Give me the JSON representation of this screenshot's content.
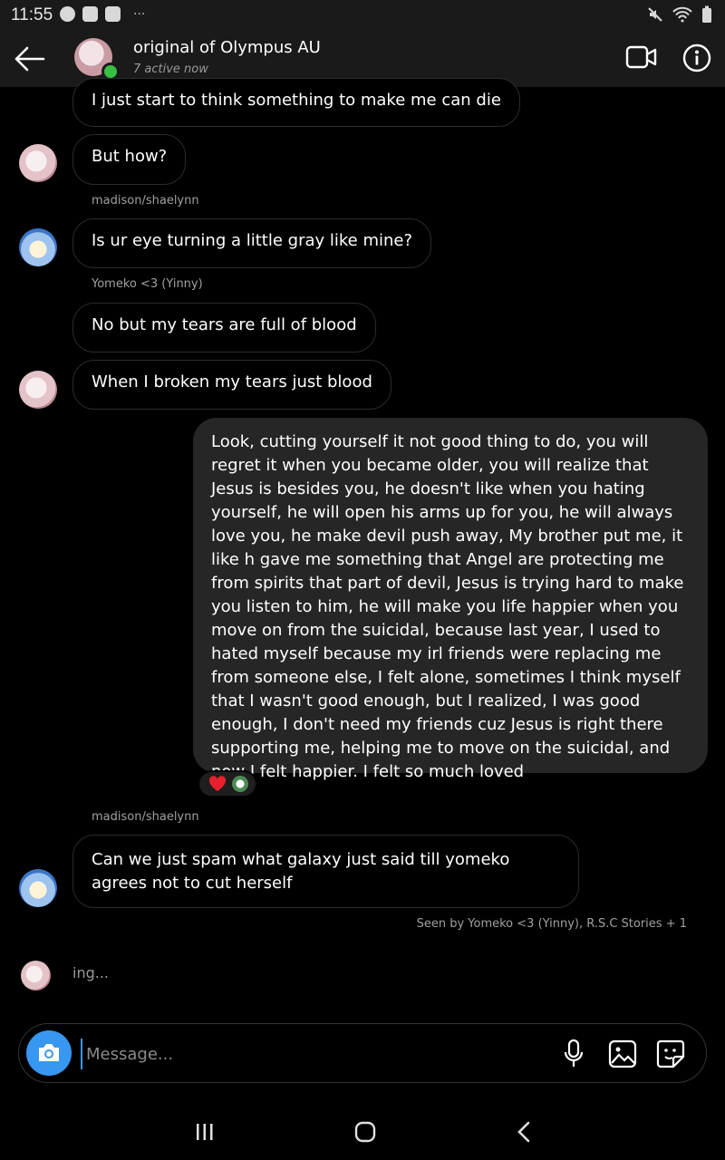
{
  "status_bar": {
    "time": "11:55",
    "overflow": "···",
    "icons": [
      "facebook-icon",
      "gallery-icon",
      "youtube-icon",
      "mute-icon",
      "wifi-icon",
      "battery-icon"
    ]
  },
  "header": {
    "title": "original of Olympus AU",
    "subtitle": "7 active now",
    "online_color": "#37c044"
  },
  "messages": [
    {
      "id": "m1",
      "direction": "in",
      "sender": "",
      "text": "I just start to think something to make me can die"
    },
    {
      "id": "m2",
      "direction": "in",
      "sender": "",
      "text": "But how?"
    },
    {
      "id": "m3",
      "direction": "in",
      "sender": "madison/shaelynn",
      "text": "Is ur eye turning a little gray like mine?"
    },
    {
      "id": "m4",
      "direction": "in",
      "sender": "Yomeko <3 (Yinny)",
      "text": "No but my tears are full of blood"
    },
    {
      "id": "m5",
      "direction": "in",
      "sender": "",
      "text": "When I broken my tears just blood"
    },
    {
      "id": "m6",
      "direction": "out",
      "sender": "",
      "text": "Look, cutting yourself it not good thing to do, you will regret it when you became older, you will realize that Jesus is besides you, he doesn't like when you hating yourself, he will open his arms up for you, he will always love you, he make devil push away, My brother put me, it like h gave me something that Angel are protecting me from  spirits that part of devil, Jesus is trying hard to make you listen to him, he will make you life happier when you move on from the suicidal, because last year, I used to hated myself because my  irl friends were replacing me from someone else, I felt alone, sometimes I think myself that I wasn't good enough, but I realized, I was good enough, I don't need my friends cuz Jesus is right there supporting me, helping me to move on the suicidal, and now I felt happier. I felt so much loved",
      "reactions": [
        "heart-icon",
        "reactor-avatar"
      ]
    },
    {
      "id": "m7",
      "direction": "in",
      "sender": "madison/shaelynn",
      "text": "Can we just spam what galaxy just said till yomeko agrees not to cut herself"
    }
  ],
  "seen_by": "Seen by Yomeko <3 (Yinny), R.S.C Stories + 1",
  "typing": "ing...",
  "composer": {
    "placeholder": "Message...",
    "value": "",
    "accent": "#3897f0"
  },
  "colors": {
    "background": "#000000",
    "outgoing_bubble": "#262626",
    "incoming_border": "#2b2b2b",
    "reaction_heart": "#e8202e"
  }
}
